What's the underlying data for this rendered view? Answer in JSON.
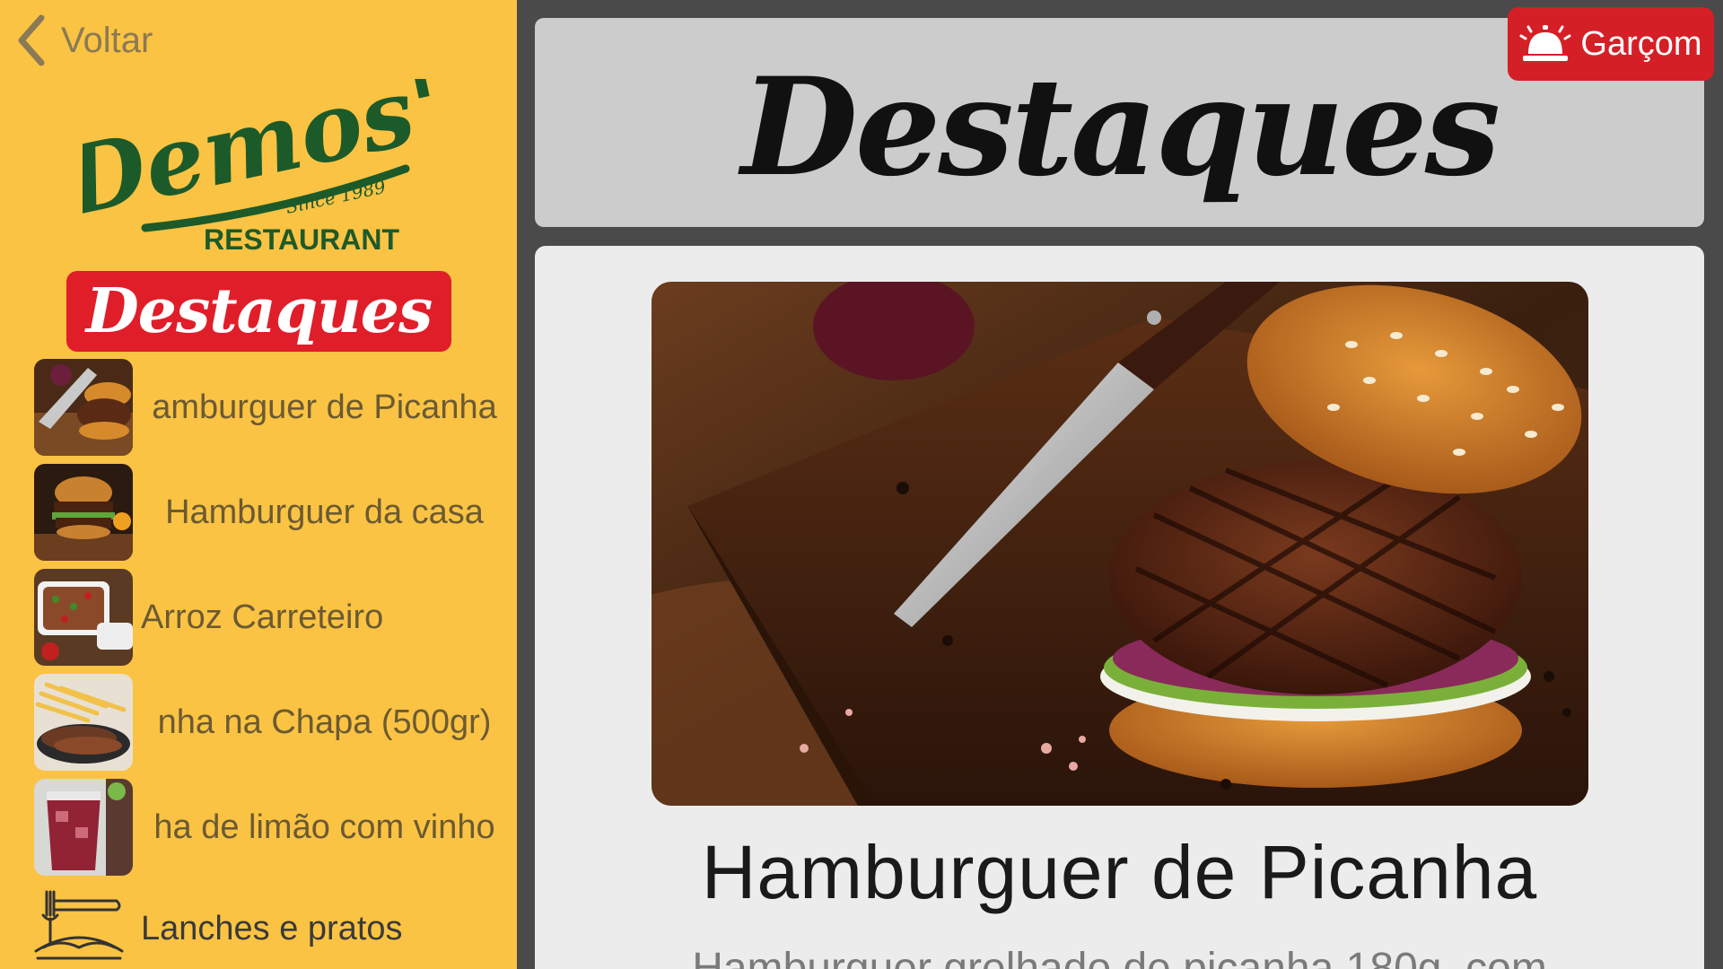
{
  "sidebar": {
    "back_label": "Voltar",
    "logo": {
      "name": "Demos'",
      "since": "Since 1989",
      "subtitle": "RESTAURANT"
    },
    "section_title": "Destaques",
    "items": [
      {
        "label": "amburguer de Picanha",
        "thumb": "burger-knife"
      },
      {
        "label": "Hamburguer da casa",
        "thumb": "burger-house"
      },
      {
        "label": "Arroz Carreteiro",
        "thumb": "rice-dish"
      },
      {
        "label": "nha na Chapa (500gr)",
        "thumb": "steak-fries"
      },
      {
        "label": "ha de limão com vinho",
        "thumb": "wine-drink"
      }
    ],
    "category": {
      "label": "Lanches e pratos",
      "icon": "noodles-icon"
    }
  },
  "header": {
    "title": "Destaques",
    "waiter_button": "Garçom"
  },
  "product": {
    "title": "Hamburguer de Picanha",
    "description": "Hamburguer grelhado de picanha 180g, com"
  },
  "colors": {
    "sidebar_bg": "#fbc343",
    "accent_red": "#e01e2a",
    "logo_green": "#1d5a2a",
    "header_bg": "#cccccc",
    "content_bg": "#ececec",
    "frame_bg": "#4a4a4a"
  }
}
